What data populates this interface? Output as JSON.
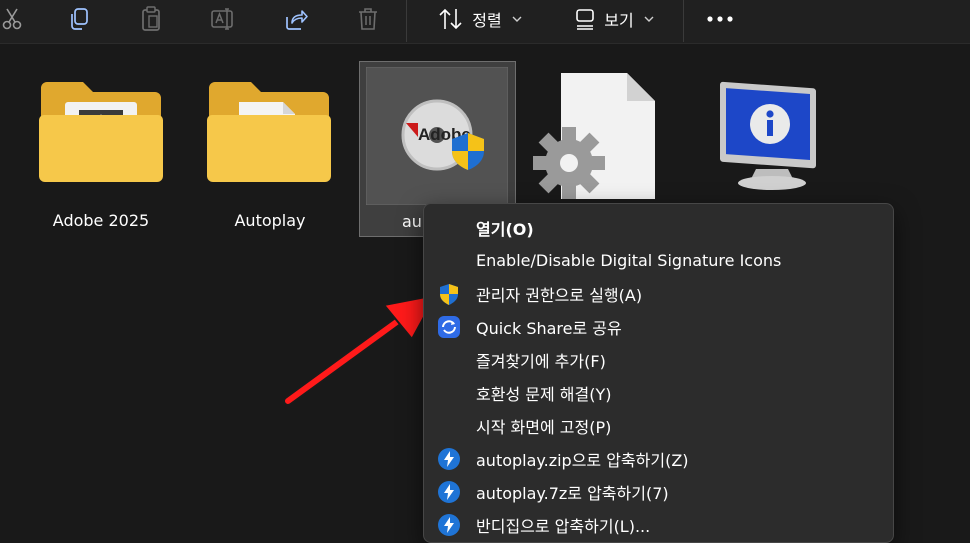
{
  "toolbar": {
    "icons": [
      "cut-icon",
      "copy-icon",
      "paste-icon",
      "rename-icon",
      "share-icon",
      "delete-icon"
    ],
    "sort_label": "정렬",
    "view_label": "보기",
    "more_icon": "more-icon"
  },
  "files": [
    {
      "name": "Adobe 2025",
      "type": "folder"
    },
    {
      "name": "Autoplay",
      "type": "folder"
    },
    {
      "name": "au",
      "type": "exe"
    },
    {
      "name": "",
      "type": "settings-file"
    },
    {
      "name": "",
      "type": "info-file"
    }
  ],
  "context_menu": {
    "items": [
      {
        "label": "열기(O)",
        "bold": true,
        "icon": ""
      },
      {
        "label": "Enable/Disable Digital Signature Icons",
        "icon": ""
      },
      {
        "label": "관리자 권한으로 실행(A)",
        "icon": "uac-shield-icon"
      },
      {
        "label": "Quick Share로 공유",
        "icon": "quick-share-icon"
      },
      {
        "label": "즐겨찾기에 추가(F)",
        "icon": ""
      },
      {
        "label": "호환성 문제 해결(Y)",
        "icon": ""
      },
      {
        "label": "시작 화면에 고정(P)",
        "icon": ""
      },
      {
        "label": "autoplay.zip으로 압축하기(Z)",
        "icon": "bandizip-icon"
      },
      {
        "label": "autoplay.7z로 압축하기(7)",
        "icon": "bandizip-icon"
      },
      {
        "label": "반디집으로 압축하기(L)...",
        "icon": "bandizip-icon"
      }
    ]
  },
  "colors": {
    "background": "#191919",
    "toolbar": "#202020",
    "menu": "#2c2c2c",
    "accent_arrow": "#ff1a1a",
    "folder": "#f6c84a"
  }
}
